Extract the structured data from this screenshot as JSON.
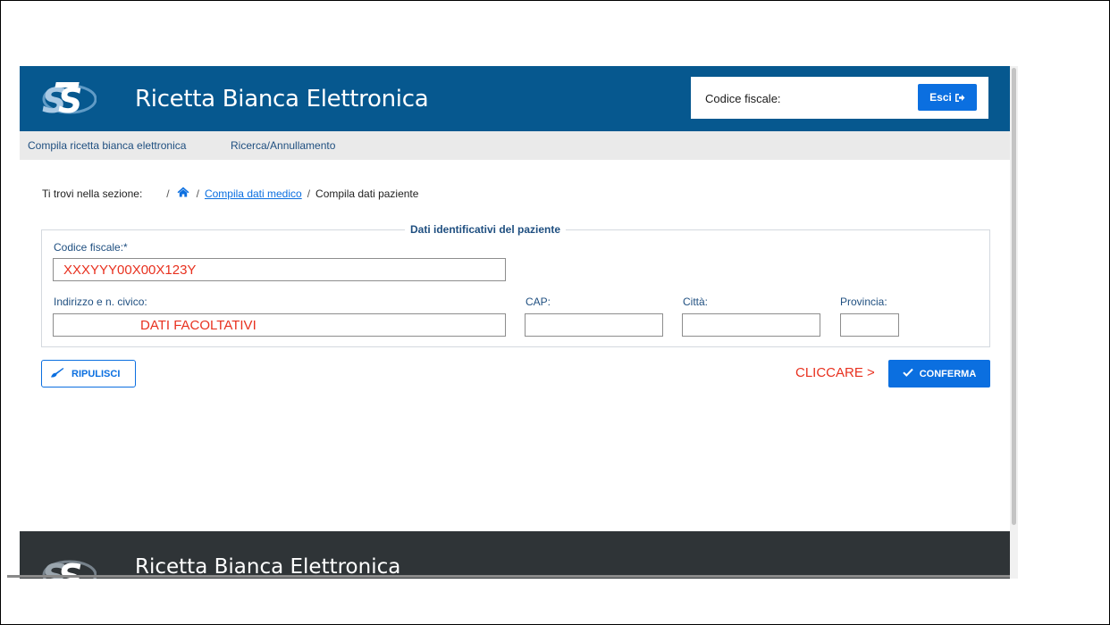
{
  "header": {
    "app_title": "Ricetta Bianca Elettronica",
    "user_label": "Codice fiscale:",
    "logout_label": "Esci",
    "logo_icon": "sts-logo-icon",
    "logout_icon": "logout-icon"
  },
  "nav": {
    "items": [
      "Compila ricetta bianca elettronica",
      "Ricerca/Annullamento"
    ]
  },
  "breadcrumb": {
    "prefix": "Ti trovi nella sezione:",
    "home_icon": "home-icon",
    "link": "Compila dati medico",
    "current": "Compila dati paziente"
  },
  "form": {
    "legend": "Dati identificativi del paziente",
    "codice_fiscale": {
      "label": "Codice fiscale:*",
      "value": "XXXYYY00X00X123Y"
    },
    "indirizzo": {
      "label": "Indirizzo e n. civico:",
      "value": "DATI FACOLTATIVI"
    },
    "cap": {
      "label": "CAP:",
      "value": ""
    },
    "citta": {
      "label": "Città:",
      "value": ""
    },
    "provincia": {
      "label": "Provincia:",
      "value": ""
    }
  },
  "actions": {
    "clear_label": "RIPULISCI",
    "clear_icon": "brush-icon",
    "hint": "CLICCARE >",
    "confirm_label": "CONFERMA",
    "confirm_icon": "check-icon"
  },
  "footer": {
    "title": "Ricetta Bianca Elettronica"
  },
  "colors": {
    "header_bg": "#06588f",
    "nav_bg": "#eaeaea",
    "primary": "#0b6fe0",
    "annotation_red": "#e8311f",
    "footer_bg": "#2f3437"
  }
}
